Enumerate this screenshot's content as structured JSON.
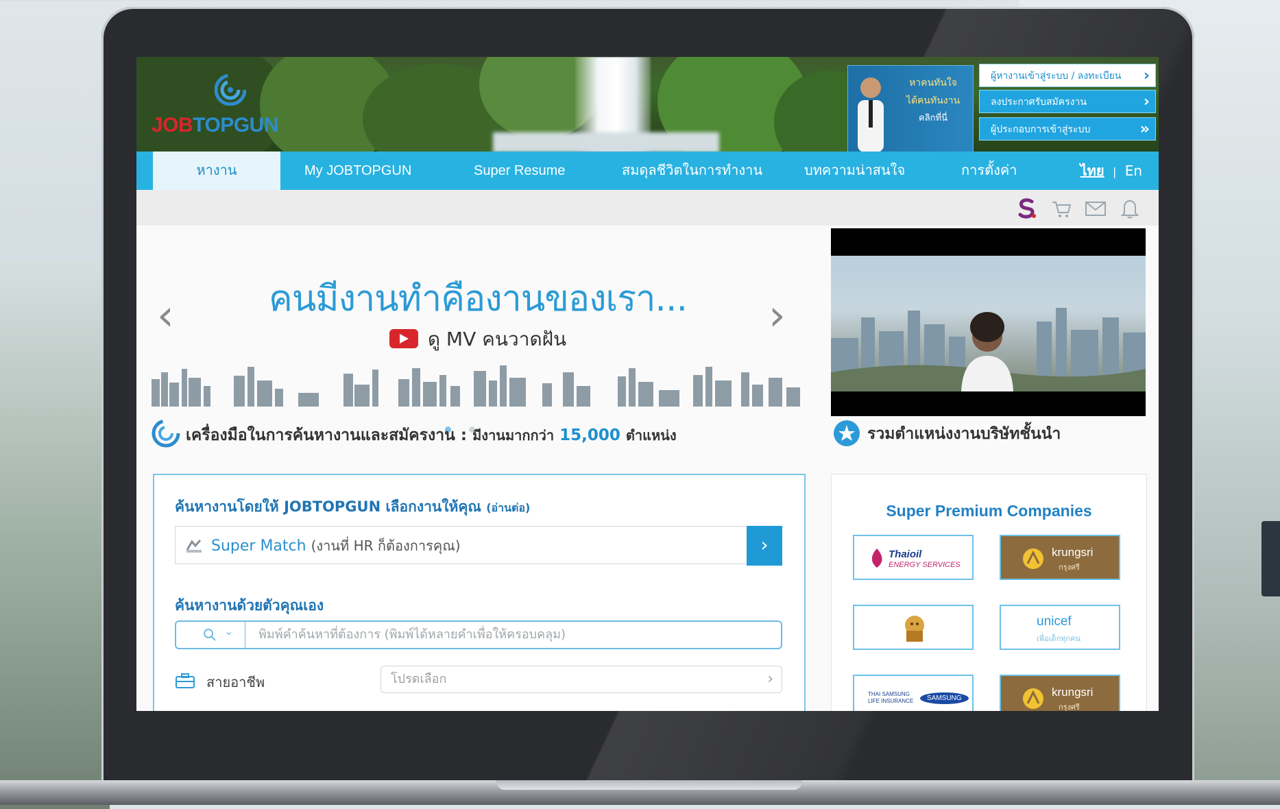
{
  "header": {
    "logo_part1": "JOB",
    "logo_part2": "TOPGUN",
    "promo_lines": [
      "หาคนทันใจ",
      "ได้คนทันงาน",
      "คลิกที่นี่"
    ],
    "buttons": [
      {
        "label": "ผู้หางานเข้าสู่ระบบ / ลงทะเบียน",
        "icon": "chevron-right"
      },
      {
        "label": "ลงประกาศรับสมัครงาน",
        "icon": "chevron-right"
      },
      {
        "label": "ผู้ประกอบการเข้าสู่ระบบ",
        "icon": "double-chevron-right"
      }
    ]
  },
  "nav": {
    "items": [
      "หางาน",
      "My JOBTOPGUN",
      "Super Resume",
      "สมดุลชีวิตในการทำงาน",
      "บทความน่าสนใจ",
      "การตั้งค่า"
    ],
    "active_index": 0,
    "lang_th": "ไทย",
    "lang_sep": "|",
    "lang_en": "En"
  },
  "toolbar": {
    "icons": [
      "super-resume-icon",
      "cart-icon",
      "mail-icon",
      "bell-icon"
    ],
    "accent_color": "#7a2a7f"
  },
  "hero": {
    "title": "คนมีงานทำคืองานของเรา...",
    "subtitle": "ดู MV คนวาดฝัน",
    "slides": 2,
    "active_slide": 0
  },
  "tools_section": {
    "heading": "เครื่องมือในการค้นหางานและสมัครงาน :",
    "count_prefix": "มีงานมากกว่า",
    "count": "15,000",
    "count_suffix": "ตำแหน่ง"
  },
  "companies_section": {
    "heading": "รวมตำแหน่งงานบริษัทชั้นนำ",
    "panel_title": "Super Premium Companies",
    "logos": [
      {
        "name": "Thaioil Energy Services",
        "line1": "Thaioil",
        "line2": "ENERGY SERVICES"
      },
      {
        "name": "krungsri",
        "line1": "krungsri",
        "line2": "กรุงศรี"
      },
      {
        "name": "Siam company lion logo",
        "line1": "",
        "line2": ""
      },
      {
        "name": "unicef",
        "line1": "unicef",
        "line2": "เพื่อเด็กทุกคน"
      },
      {
        "name": "Thai Samsung Life Insurance",
        "line1": "THAI SAMSUNG LIFE INSURANCE",
        "line2": "SAMSUNG"
      },
      {
        "name": "krungsri",
        "line1": "krungsri",
        "line2": "กรุงศรี"
      }
    ]
  },
  "search": {
    "match_heading": "ค้นหางานโดยให้ JOBTOPGUN เลือกงานให้คุณ",
    "match_hint": "(อ่านต่อ)",
    "match_label": "Super Match",
    "match_desc": "(งานที่ HR ก็ต้องการคุณ)",
    "self_heading": "ค้นหางานด้วยตัวคุณเอง",
    "keyword_placeholder": "พิมพ์คำค้นหาที่ต้องการ (พิมพ์ได้หลายคำเพื่อให้ครอบคลุม)",
    "career_label": "สายอาชีพ",
    "career_placeholder": "โปรดเลือก"
  },
  "colors": {
    "nav_blue": "#28b2e1",
    "brand_red": "#d8262c",
    "brand_blue": "#2e8ccc"
  }
}
